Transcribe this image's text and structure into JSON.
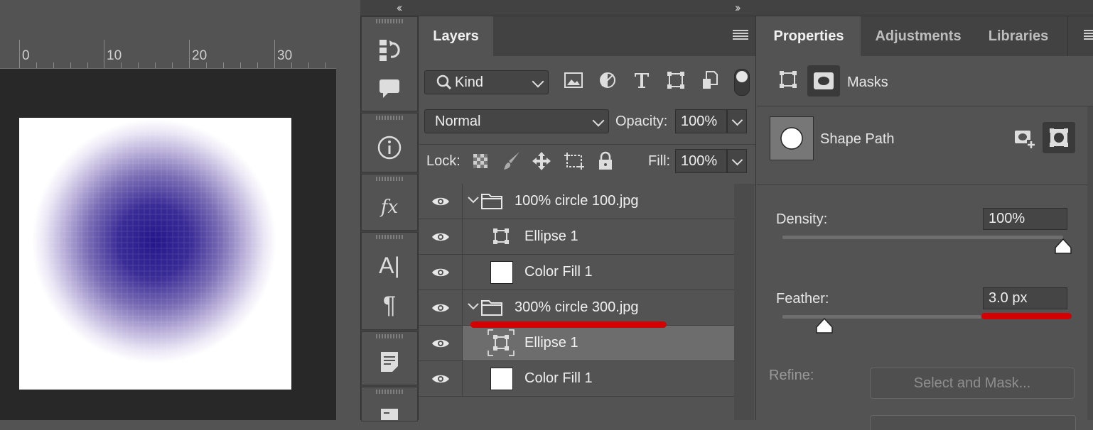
{
  "window": {
    "left_collapse": "‹‹",
    "right_collapse": "››"
  },
  "ruler": {
    "labels": [
      "0",
      "10",
      "20",
      "30"
    ]
  },
  "tools": {
    "icons": [
      "history-icon",
      "comment-icon",
      "info-icon",
      "fx-icon",
      "character-icon",
      "paragraph-icon",
      "notes-icon",
      "table-icon"
    ],
    "fx_label": "fx",
    "character_label": "A|",
    "paragraph_label": "¶"
  },
  "layers": {
    "tab_label": "Layers",
    "kind_label": "Kind",
    "blend_mode": "Normal",
    "opacity_label": "Opacity:",
    "opacity_value": "100%",
    "lock_label": "Lock:",
    "fill_label": "Fill:",
    "fill_value": "100%",
    "filter_icons": [
      "image-filter-icon",
      "adjustment-filter-icon",
      "type-filter-icon",
      "shape-filter-icon",
      "smart-object-filter-icon"
    ],
    "rows": [
      {
        "name": "100% circle 100.jpg",
        "type": "group",
        "visible": true
      },
      {
        "name": "Ellipse 1",
        "type": "shape",
        "visible": true
      },
      {
        "name": "Color Fill 1",
        "type": "fill",
        "visible": true
      },
      {
        "name": "300% circle 300.jpg",
        "type": "group",
        "visible": true
      },
      {
        "name": "Ellipse 1",
        "type": "shape",
        "visible": true,
        "selected": true
      },
      {
        "name": "Color Fill 1",
        "type": "fill",
        "visible": true
      }
    ]
  },
  "properties": {
    "tabs": [
      "Properties",
      "Adjustments",
      "Libraries"
    ],
    "mask_label": "Masks",
    "shape_path_label": "Shape Path",
    "density_label": "Density:",
    "density_value": "100%",
    "density_level": 1.0,
    "feather_label": "Feather:",
    "feather_value": "3.0 px",
    "feather_level": 0.15,
    "refine_label": "Refine:",
    "select_mask_label": "Select and Mask..."
  },
  "colors": {
    "panel_bg": "#535353",
    "dark_bg": "#424242",
    "pasteboard": "#282828",
    "highlight_red": "#d40000",
    "circle_center": "#2a1a8f"
  }
}
